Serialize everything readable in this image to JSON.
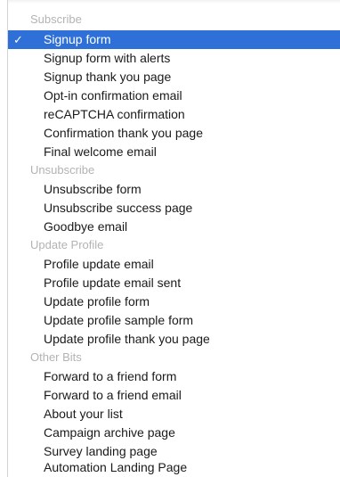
{
  "menu": {
    "groups": [
      {
        "header": "Subscribe",
        "items": [
          "Signup form",
          "Signup form with alerts",
          "Signup thank you page",
          "Opt-in confirmation email",
          "reCAPTCHA confirmation",
          "Confirmation thank you page",
          "Final welcome email"
        ]
      },
      {
        "header": "Unsubscribe",
        "items": [
          "Unsubscribe form",
          "Unsubscribe success page",
          "Goodbye email"
        ]
      },
      {
        "header": "Update Profile",
        "items": [
          "Profile update email",
          "Profile update email sent",
          "Update profile form",
          "Update profile sample form",
          "Update profile thank you page"
        ]
      },
      {
        "header": "Other Bits",
        "items": [
          "Forward to a friend form",
          "Forward to a friend email",
          "About your list",
          "Campaign archive page",
          "Survey landing page",
          "Automation Landing Page"
        ]
      }
    ],
    "selected_item": "Signup form",
    "selected_mark": "✓",
    "colors": {
      "selection": "#2f6fd8",
      "header_text": "#b3b3b3",
      "item_text": "#1a1a1a"
    }
  }
}
